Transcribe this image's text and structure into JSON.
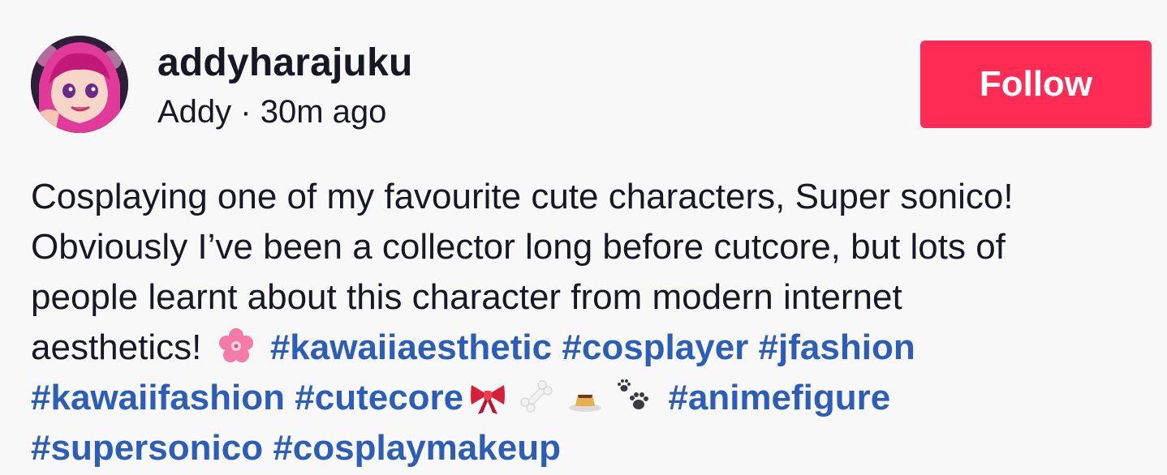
{
  "post": {
    "username": "addyharajuku",
    "display_name": "Addy",
    "separator": " · ",
    "time_ago": "30m ago",
    "follow_label": "Follow",
    "caption": {
      "line1": "Cosplaying one of my favourite cute characters, Super sonico!",
      "line2": "Obviously I’ve been a collector long before cutcore, but lots of",
      "line3": "people learnt about this character from modern internet",
      "line4_text": "aesthetics!"
    },
    "hashtags": [
      "#kawaiiaesthetic",
      "#cosplayer",
      "#jfashion",
      "#kawaiifashion",
      "#cutecore",
      "#animefigure",
      "#supersonico",
      "#cosplaymakeup"
    ],
    "emojis": [
      "cherry-blossom-icon",
      "ribbon-icon",
      "bone-icon",
      "pudding-icon",
      "paw-prints-icon"
    ]
  },
  "colors": {
    "background": "#f8f8f9",
    "follow_button": "#fe2c55",
    "hashtag": "#2b5db9",
    "text": "#161823"
  }
}
